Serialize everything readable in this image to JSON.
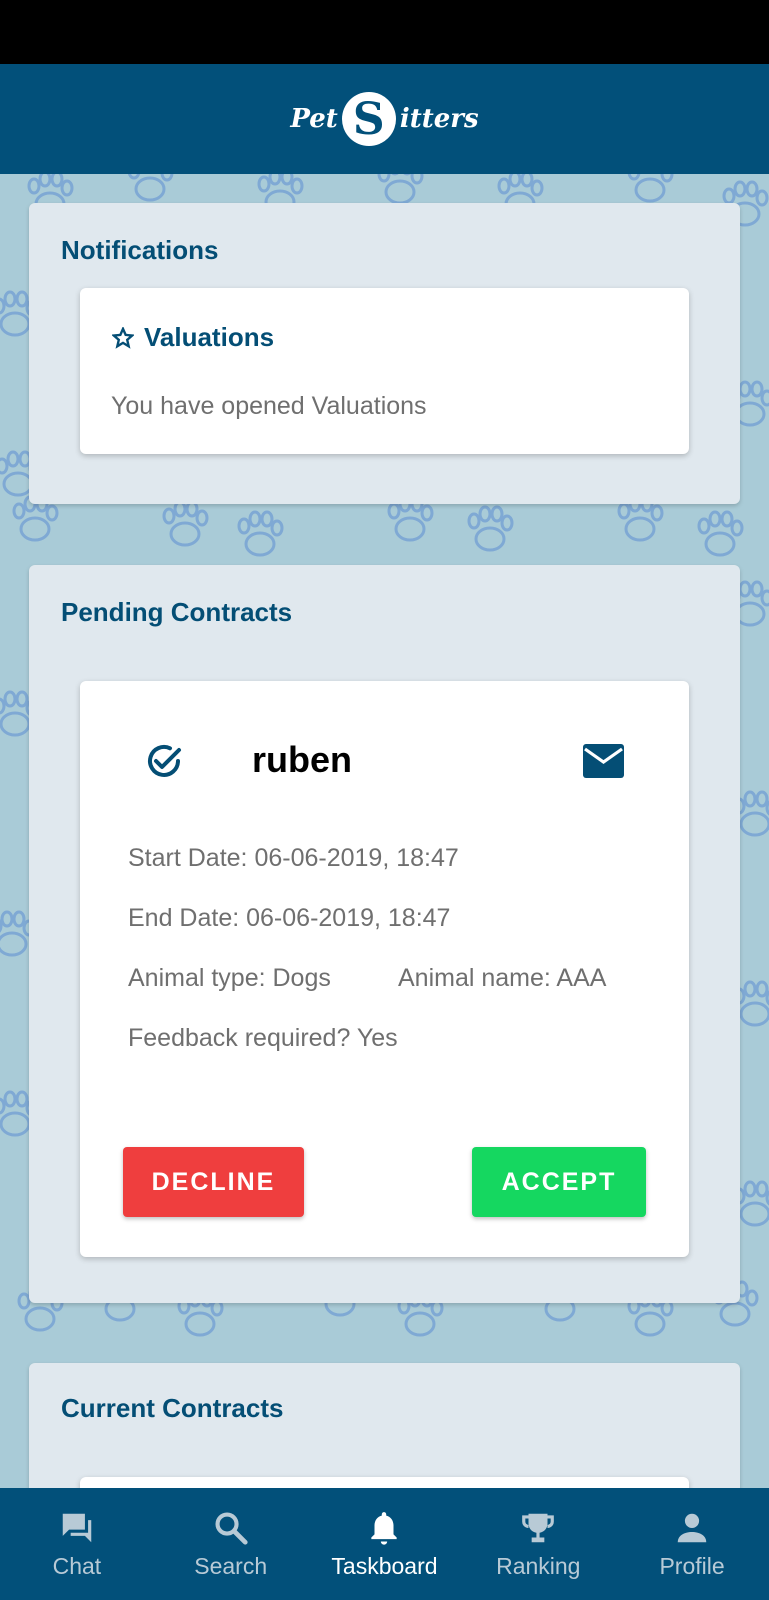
{
  "header": {
    "logo_prefix": "Pet",
    "logo_badge": "S",
    "logo_suffix": "itters"
  },
  "notifications": {
    "title": "Notifications",
    "card": {
      "icon": "star-icon",
      "title": "Valuations",
      "message": "You have opened Valuations"
    }
  },
  "pending": {
    "title": "Pending Contracts",
    "contract": {
      "status_icon": "check-circle-icon",
      "name": "ruben",
      "mail_icon": "mail-icon",
      "start_date": "Start Date: 06-06-2019, 18:47",
      "end_date": "End Date: 06-06-2019, 18:47",
      "animal_type": "Animal type: Dogs",
      "animal_name": "Animal name: AAA",
      "feedback": "Feedback required? Yes",
      "decline_label": "DECLINE",
      "accept_label": "ACCEPT"
    }
  },
  "current": {
    "title": "Current Contracts"
  },
  "nav": {
    "items": [
      {
        "label": "Chat",
        "icon": "chat-icon"
      },
      {
        "label": "Search",
        "icon": "search-icon"
      },
      {
        "label": "Taskboard",
        "icon": "bell-icon",
        "active": true
      },
      {
        "label": "Ranking",
        "icon": "trophy-icon"
      },
      {
        "label": "Profile",
        "icon": "person-icon"
      }
    ]
  },
  "colors": {
    "header": "#02507a",
    "accent_text": "#044e75",
    "decline": "#ef3e3e",
    "accept": "#15d760",
    "background": "#a9cbd7"
  }
}
